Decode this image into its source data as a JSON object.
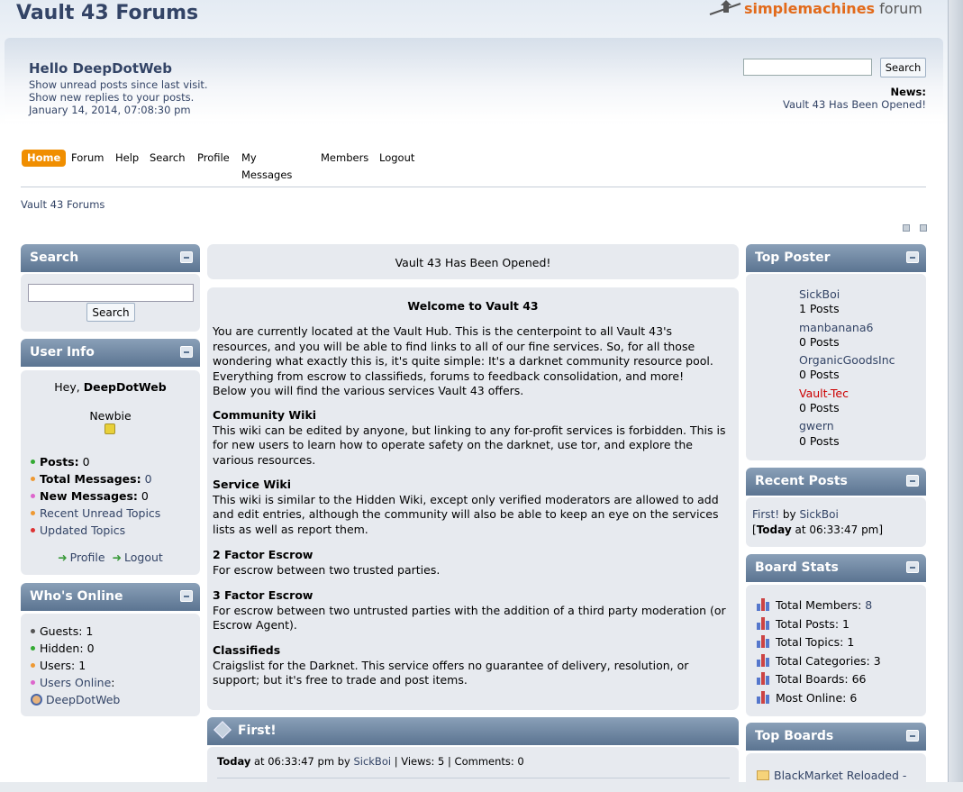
{
  "header": {
    "site_title": "Vault 43 Forums",
    "logo_simple": "simple",
    "logo_machines": "machines",
    "logo_forum": " forum"
  },
  "user_panel": {
    "greeting_prefix": "Hello ",
    "username": "DeepDotWeb",
    "unread_posts_link": "Show unread posts since last visit.",
    "new_replies_link": "Show new replies to your posts.",
    "datetime": "January 14, 2014, 07:08:30 pm"
  },
  "top_search": {
    "value": "",
    "button": "Search"
  },
  "news": {
    "label": "News:",
    "text": "Vault 43 Has Been Opened!"
  },
  "menu": [
    {
      "label": "Home",
      "active": true
    },
    {
      "label": "Forum"
    },
    {
      "label": "Help"
    },
    {
      "label": "Search"
    },
    {
      "label": "Profile"
    },
    {
      "label": "My Messages"
    },
    {
      "label": "Members"
    },
    {
      "label": "Logout"
    }
  ],
  "breadcrumb": "Vault 43 Forums",
  "left": {
    "search": {
      "title": "Search",
      "button": "Search",
      "value": ""
    },
    "user_info": {
      "title": "User Info",
      "hey": "Hey, ",
      "username": "DeepDotWeb",
      "rank": "Newbie",
      "posts_label": "Posts:",
      "posts_value": "0",
      "total_messages_label": "Total Messages:",
      "total_messages_value": "0",
      "new_messages_label": "New Messages:",
      "new_messages_value": "0",
      "recent_unread": "Recent Unread Topics",
      "updated_topics": "Updated Topics",
      "profile_link": "Profile",
      "logout_link": "Logout"
    },
    "whos_online": {
      "title": "Who's Online",
      "guests_label": "Guests:",
      "guests_value": "1",
      "hidden_label": "Hidden:",
      "hidden_value": "0",
      "users_label": "Users:",
      "users_value": "1",
      "users_online": "Users Online",
      "users_online_colon": ":",
      "online_user": "DeepDotWeb"
    }
  },
  "center": {
    "announcement": "Vault 43 Has Been Opened!",
    "welcome_title": "Welcome to Vault 43",
    "intro_lines": [
      "You are currently located at the Vault Hub. This is the centerpoint to all Vault 43's",
      "resources, and you will be able to find links to all of our fine services. So, for all those",
      "wondering what exactly this is, it's quite simple: It's a darknet community resource pool.",
      "Everything from escrow to classifieds, forums to feedback consolidation, and more!",
      "Below you will find the various services Vault 43 offers."
    ],
    "sections": [
      {
        "title": "Community Wiki",
        "lines": [
          "This wiki can be edited by anyone, but linking to any for-profit services is forbidden. This is",
          "for new users to learn how to operate safety on the darknet, use tor, and explore the",
          "various resources."
        ]
      },
      {
        "title": "Service Wiki",
        "lines": [
          "This wiki is similar to the Hidden Wiki, except only verified moderators are allowed to add",
          "and edit entries, although the community will also be able to keep an eye on the services",
          "lists as well as report them."
        ]
      },
      {
        "title": "2 Factor Escrow",
        "lines": [
          "For escrow between two trusted parties."
        ]
      },
      {
        "title": "3 Factor Escrow",
        "lines": [
          "For escrow between two untrusted parties with the addition of a third party moderation (or",
          "Escrow Agent)."
        ]
      },
      {
        "title": "Classifieds",
        "lines": [
          "Craigslist for the Darknet. This service offers no guarantee of delivery, resolution, or",
          "support; but it's free to trade and post items."
        ]
      }
    ],
    "post": {
      "title": "First!",
      "date_bold": "Today",
      "time": " at 06:33:47 pm by ",
      "author": "SickBoi",
      "meta": " | Views: 5 | Comments: 0"
    }
  },
  "right": {
    "top_poster": {
      "title": "Top Poster",
      "users": [
        {
          "name": "SickBoi",
          "posts": "1 Posts",
          "color": "#334466"
        },
        {
          "name": "manbanana6",
          "posts": "0 Posts",
          "color": "#334466"
        },
        {
          "name": "OrganicGoodsInc",
          "posts": "0 Posts",
          "color": "#334466"
        },
        {
          "name": "Vault-Tec",
          "posts": "0 Posts",
          "color": "#cc0000"
        },
        {
          "name": "gwern",
          "posts": "0 Posts",
          "color": "#334466"
        }
      ]
    },
    "recent_posts": {
      "title": "Recent Posts",
      "topic": "First!",
      "by": " by ",
      "author": "SickBoi",
      "open": "[",
      "today": "Today",
      "time": " at 06:33:47 pm]"
    },
    "board_stats": {
      "title": "Board Stats",
      "rows": [
        {
          "label": "Total Members: ",
          "value": "8",
          "value_link": true
        },
        {
          "label": "Total Posts: ",
          "value": "1"
        },
        {
          "label": "Total Topics: ",
          "value": "1"
        },
        {
          "label": "Total Categories: ",
          "value": "3"
        },
        {
          "label": "Total Boards: ",
          "value": "66"
        },
        {
          "label": "Most Online: ",
          "value": "6"
        }
      ]
    },
    "top_boards": {
      "title": "Top Boards",
      "first_board": "BlackMarket Reloaded -"
    }
  },
  "colors": {
    "brand": "#334466",
    "menu_active": "#f08e00",
    "block_header": "#5b7491",
    "block_body": "#e7eaef",
    "dot_green": "#33aa33",
    "dot_orange": "#ee9933",
    "dot_pink": "#dd66cc",
    "dot_red": "#dd3333",
    "dot_gray": "#555555"
  }
}
